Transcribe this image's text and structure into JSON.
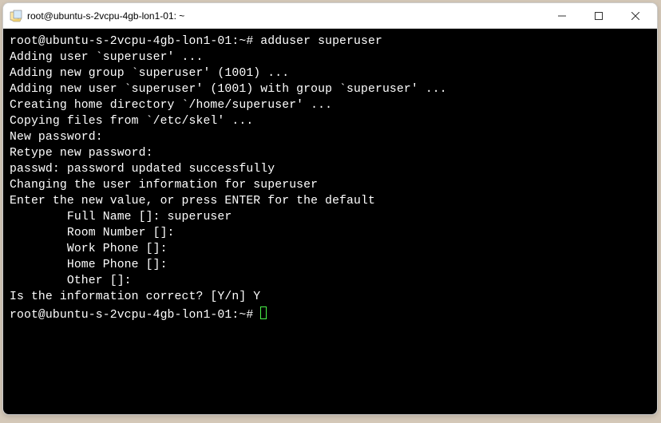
{
  "window": {
    "title": "root@ubuntu-s-2vcpu-4gb-lon1-01: ~"
  },
  "terminal": {
    "lines": [
      "root@ubuntu-s-2vcpu-4gb-lon1-01:~# adduser superuser",
      "Adding user `superuser' ...",
      "Adding new group `superuser' (1001) ...",
      "Adding new user `superuser' (1001) with group `superuser' ...",
      "Creating home directory `/home/superuser' ...",
      "Copying files from `/etc/skel' ...",
      "New password:",
      "Retype new password:",
      "passwd: password updated successfully",
      "Changing the user information for superuser",
      "Enter the new value, or press ENTER for the default",
      "        Full Name []: superuser",
      "        Room Number []:",
      "        Work Phone []:",
      "        Home Phone []:",
      "        Other []:",
      "Is the information correct? [Y/n] Y"
    ],
    "prompt": "root@ubuntu-s-2vcpu-4gb-lon1-01:~# "
  }
}
